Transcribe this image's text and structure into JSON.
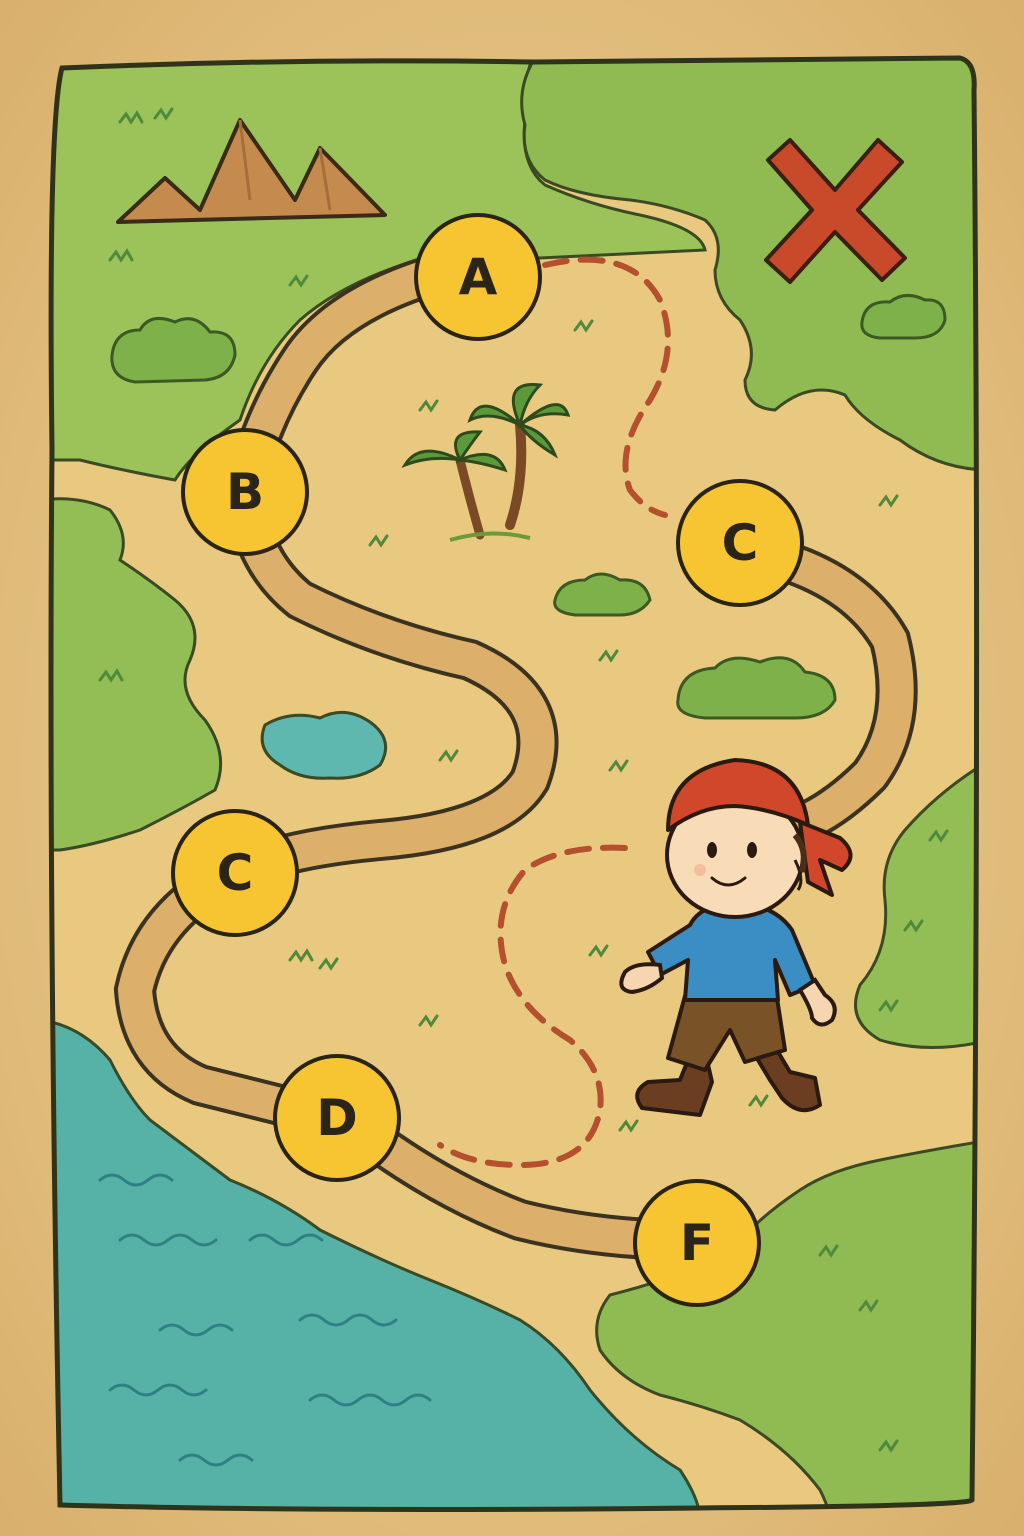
{
  "waypoints": [
    {
      "id": "A",
      "label": "A"
    },
    {
      "id": "B",
      "label": "B"
    },
    {
      "id": "C1",
      "label": "C"
    },
    {
      "id": "C2",
      "label": "C"
    },
    {
      "id": "D",
      "label": "D"
    },
    {
      "id": "F",
      "label": "F"
    }
  ],
  "icons": {
    "treasure": "x-mark-icon",
    "explorer": "pirate-boy-icon",
    "mountains": "mountain-icon",
    "palms": "palm-tree-icon"
  },
  "colors": {
    "parchment": "#e8c98a",
    "sand": "#e9c97f",
    "land": "#8fbb52",
    "water": "#56b2a6",
    "path": "#dcb06a",
    "dashed_route": "#b5502e",
    "x_mark": "#c9492b",
    "waypoint": "#f7c531"
  }
}
